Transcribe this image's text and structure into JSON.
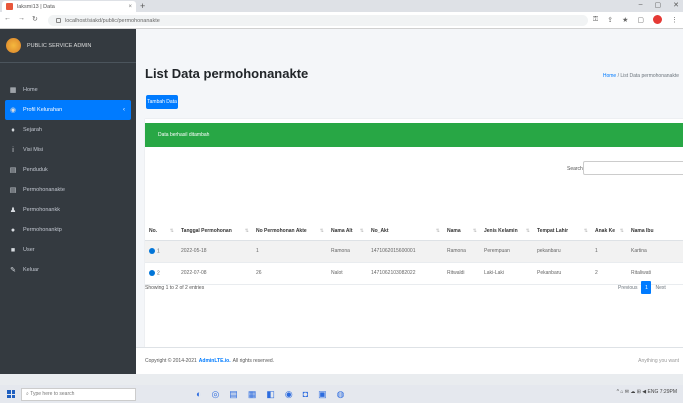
{
  "browser": {
    "tab_title": "laksmi13 | Data",
    "tab_close": "×",
    "new_tab": "+",
    "url": "localhost/siakd/public/permohonanakte",
    "win_min": "–",
    "win_max": "▢",
    "win_close": "✕"
  },
  "sidebar": {
    "brand": "PUBLIC SERVICE ADMIN",
    "items": [
      {
        "icon": "home-icon",
        "glyph": "▦",
        "label": "Home"
      },
      {
        "icon": "user-icon",
        "glyph": "◉",
        "label": "Profil Kelurahan"
      },
      {
        "icon": "pin-icon",
        "glyph": "♦",
        "label": "Sejarah"
      },
      {
        "icon": "info-icon",
        "glyph": "i",
        "label": "Visi Misi"
      },
      {
        "icon": "list-icon",
        "glyph": "▤",
        "label": "Penduduk"
      },
      {
        "icon": "list-icon",
        "glyph": "▤",
        "label": "Permohonanakte"
      },
      {
        "icon": "person-icon",
        "glyph": "♟",
        "label": "Permohonankk"
      },
      {
        "icon": "globe-icon",
        "glyph": "●",
        "label": "Permohonanktp"
      },
      {
        "icon": "chat-icon",
        "glyph": "■",
        "label": "User"
      },
      {
        "icon": "key-icon",
        "glyph": "✎",
        "label": "Keluar"
      }
    ]
  },
  "page": {
    "title": "List Data permohonanakte",
    "breadcrumb_home": "Home",
    "breadcrumb_sep": "/",
    "breadcrumb_current": "List Data permohonanakte",
    "add_button": "Tambah Data",
    "alert": "Data berhasil ditambah",
    "search_label": "Search:",
    "columns": [
      "No.",
      "Tanggal Permohonan",
      "No Permohonan Akte",
      "Nama Alt",
      "No_Akt",
      "Nama",
      "Jenis Kelamin",
      "Tempat Lahir",
      "Anak Ke",
      "Nama Ibu"
    ],
    "rows": [
      [
        "1",
        "2022-05-18",
        "1",
        "Ramona",
        "1471062015600001",
        "Ramona",
        "Perempuan",
        "pekanbaru",
        "1",
        "Kartina"
      ],
      [
        "2",
        "2022-07-08",
        "26",
        "Nalot",
        "1471062103082022",
        "Ritwaldi",
        "Laki-Laki",
        "Pekanbaru",
        "2",
        "Ritaliwati"
      ]
    ],
    "info": "Showing 1 to 2 of 2 entries",
    "prev": "Previous",
    "page_num": "1",
    "next": "Next"
  },
  "footer": {
    "prefix": "Copyright © 2014-2021",
    "link": "AdminLTE.io.",
    "suffix": "All rights reserved.",
    "right": "Anything you want"
  },
  "taskbar": {
    "search_placeholder": "Type here to search",
    "tray": "^ ⌂ ✉ ☁ ⊞ ◀ ENG 7:29PM"
  }
}
